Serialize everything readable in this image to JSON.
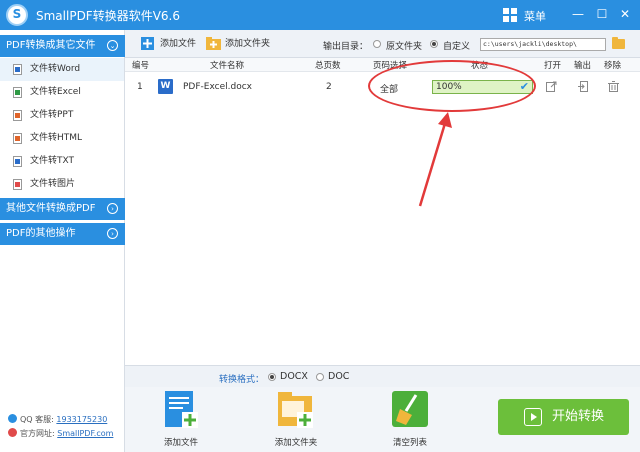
{
  "titlebar": {
    "title": "SmallPDF转换器软件V6.6",
    "menu_label": "菜单",
    "min_glyph": "—",
    "max_glyph": "☐",
    "close_glyph": "✕"
  },
  "sidebar": {
    "categories": [
      {
        "label": "PDF转换成其它文件",
        "chevron": "⌄"
      },
      {
        "label": "其他文件转换成PDF",
        "chevron": "›"
      },
      {
        "label": "PDF的其他操作",
        "chevron": "›"
      }
    ],
    "items": [
      {
        "label": "文件转Word",
        "icon": "word-file-icon",
        "color": "#2a6cc9"
      },
      {
        "label": "文件转Excel",
        "icon": "excel-file-icon",
        "color": "#2e9a45"
      },
      {
        "label": "文件转PPT",
        "icon": "ppt-file-icon",
        "color": "#e0642a"
      },
      {
        "label": "文件转HTML",
        "icon": "html-file-icon",
        "color": "#e0642a"
      },
      {
        "label": "文件转TXT",
        "icon": "txt-file-icon",
        "color": "#2a6cc9"
      },
      {
        "label": "文件转图片",
        "icon": "image-file-icon",
        "color": "#e04a4a"
      }
    ],
    "footer": {
      "qq_label": "QQ 客服:",
      "qq_value": "1933175230",
      "site_label": "官方网址:",
      "site_value": "SmallPDF.com"
    }
  },
  "toolbar": {
    "add_file": "添加文件",
    "add_folder": "添加文件夹",
    "output_label": "输出目录：",
    "radio_original": "原文件夹",
    "radio_custom": "自定义",
    "path_value": "c:\\users\\jackli\\desktop\\"
  },
  "table": {
    "headers": [
      "编号",
      "文件名称",
      "总页数",
      "页码选择",
      "状态",
      "打开",
      "输出",
      "移除"
    ],
    "rows": [
      {
        "index": "1",
        "icon": "W",
        "name": "PDF-Excel.docx",
        "pages": "2",
        "range": "全部",
        "status": "100%",
        "progress": 1.0
      }
    ]
  },
  "format": {
    "label": "转换格式：",
    "options": [
      "DOCX",
      "DOC"
    ],
    "selected": "DOCX"
  },
  "bottom": {
    "add_file": "添加文件",
    "add_folder": "添加文件夹",
    "clear_list": "清空列表",
    "start": "开始转换"
  },
  "colors": {
    "accent": "#2a8fe0",
    "start_button": "#6cbf3b",
    "annotation": "#e23a3a"
  }
}
